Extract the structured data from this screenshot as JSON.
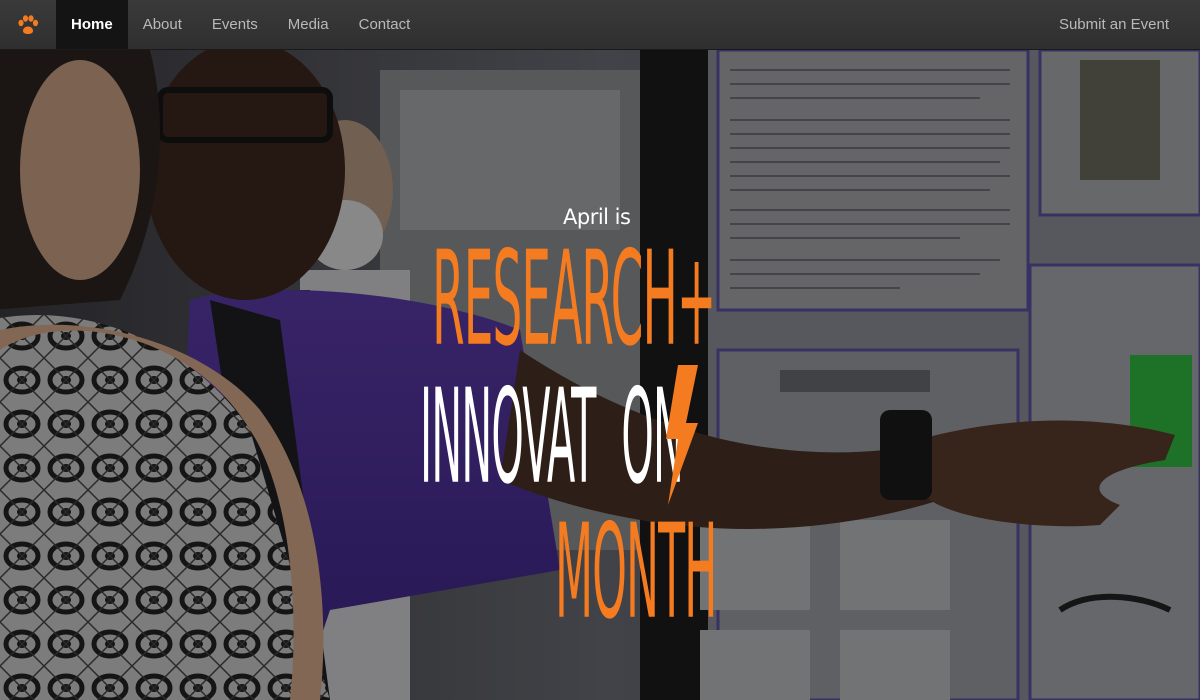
{
  "nav": {
    "brand_icon": "paw-icon",
    "brand_color": "#f47b20",
    "items": [
      {
        "label": "Home",
        "active": true
      },
      {
        "label": "About",
        "active": false
      },
      {
        "label": "Events",
        "active": false
      },
      {
        "label": "Media",
        "active": false
      },
      {
        "label": "Contact",
        "active": false
      }
    ],
    "right_link": "Submit an Event"
  },
  "hero": {
    "pre_title": "April is",
    "line1": "RESEARCH+",
    "line2_part1": "INNOVAT",
    "line2_part2": "ON",
    "line3": "MONTH",
    "accent_color": "#f47b20",
    "bolt_icon": "lightning-bolt-icon"
  }
}
